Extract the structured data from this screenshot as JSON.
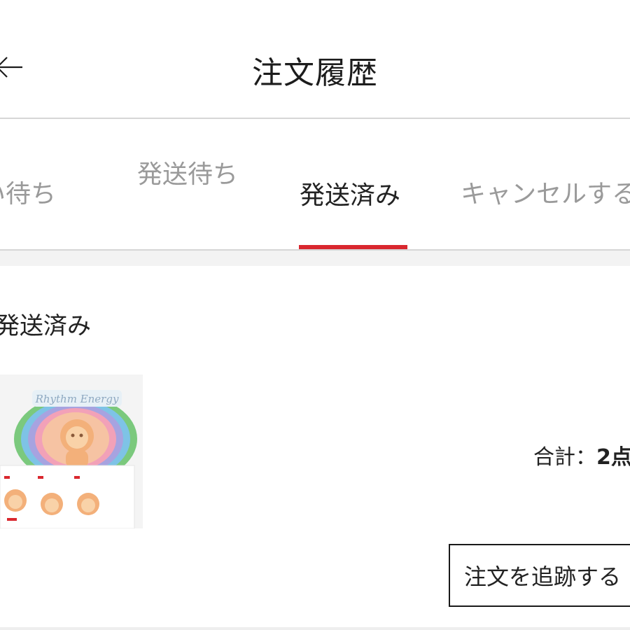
{
  "header": {
    "title": "注文履歴",
    "back_icon": "back-arrow-icon"
  },
  "tabs": [
    {
      "label": "い待ち",
      "active": false
    },
    {
      "label": "発送待ち",
      "active": false
    },
    {
      "label": "発送済み",
      "active": true
    },
    {
      "label": "キャンセルする",
      "active": false
    }
  ],
  "colors": {
    "accent": "#d9272e",
    "divider": "#d6d6d6",
    "inactive_tab": "#9a9a9a"
  },
  "order": {
    "status": "発送済み",
    "product_image_text": "Rhythm Energy",
    "total_label": "合計：",
    "total_value": "2点",
    "track_button": "注文を追跡する"
  }
}
